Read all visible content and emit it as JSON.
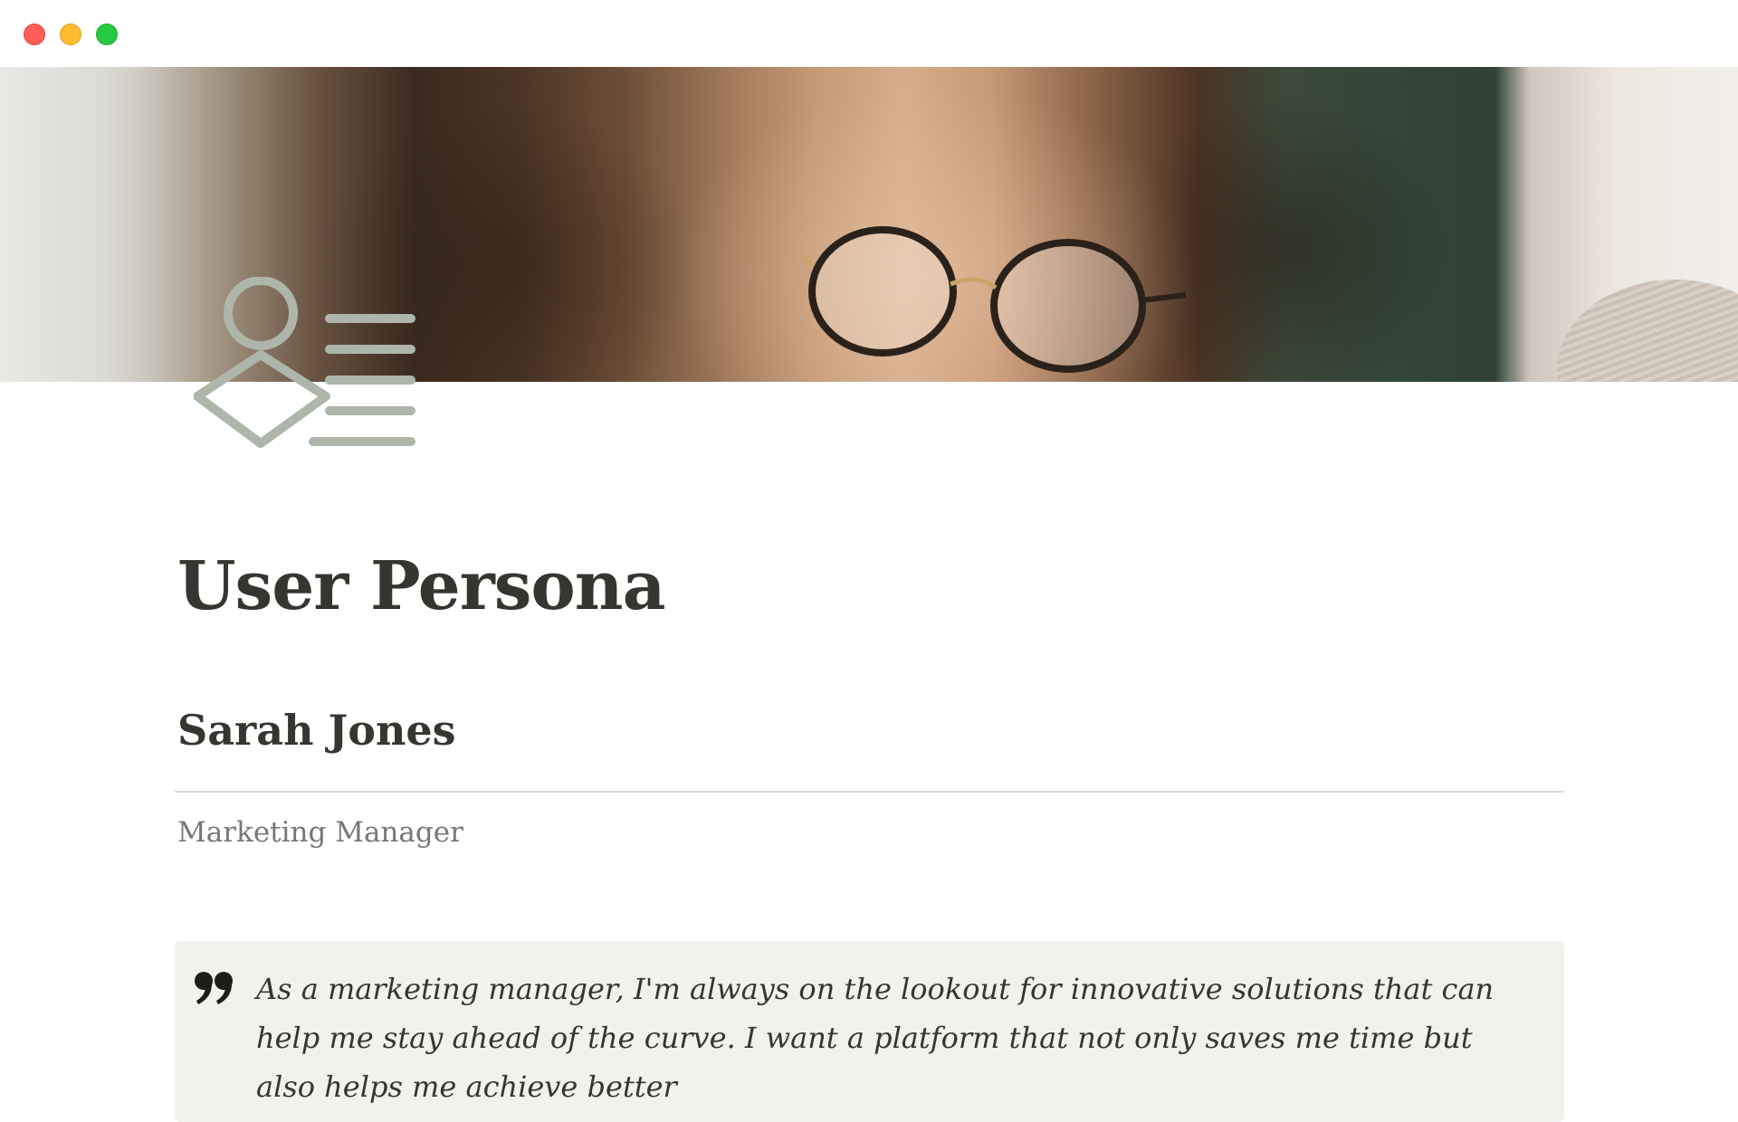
{
  "window": {
    "controls": [
      "close",
      "minimize",
      "zoom"
    ]
  },
  "cover": {
    "description_icon": "photo-cover"
  },
  "page_icon": "persona-list-icon",
  "page": {
    "title": "User Persona",
    "persona_name": "Sarah Jones",
    "role": "Marketing Manager",
    "quote": "As a marketing manager, I'm always on the lookout for innovative solutions that can help me stay ahead of the curve. I want a platform that not only saves me time but also helps me achieve better"
  },
  "colors": {
    "accent_icon": "#adb6a9",
    "callout_bg": "#f1f2ed",
    "text": "#37352f",
    "muted_text": "#787774"
  }
}
